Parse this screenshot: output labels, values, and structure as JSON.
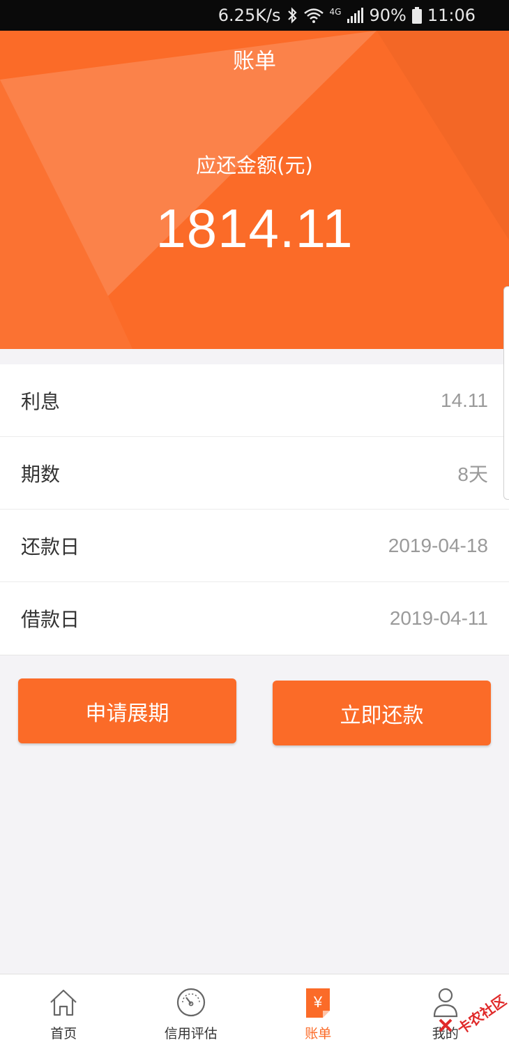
{
  "status_bar": {
    "speed": "6.25K/s",
    "network": "4G",
    "battery": "90%",
    "time": "11:06",
    "icons": [
      "bluetooth-icon",
      "wifi-icon",
      "signal-icon",
      "battery-icon"
    ]
  },
  "header": {
    "title": "账单",
    "amount_label": "应还金额(元)",
    "amount": "1814.11"
  },
  "details": [
    {
      "label": "利息",
      "value": "14.11"
    },
    {
      "label": "期数",
      "value": "8天"
    },
    {
      "label": "还款日",
      "value": "2019-04-18"
    },
    {
      "label": "借款日",
      "value": "2019-04-11"
    }
  ],
  "actions": {
    "extend_label": "申请展期",
    "repay_label": "立即还款"
  },
  "tabbar": {
    "items": [
      {
        "label": "首页",
        "icon": "home-icon",
        "active": false
      },
      {
        "label": "信用评估",
        "icon": "gauge-icon",
        "active": false
      },
      {
        "label": "账单",
        "icon": "bill-icon",
        "active": true
      },
      {
        "label": "我的",
        "icon": "person-icon",
        "active": false
      }
    ]
  },
  "watermark": {
    "text": "卡农社区"
  },
  "colors": {
    "accent": "#fb6b28",
    "background": "#f4f3f6",
    "value_gray": "#9a9a9a"
  }
}
